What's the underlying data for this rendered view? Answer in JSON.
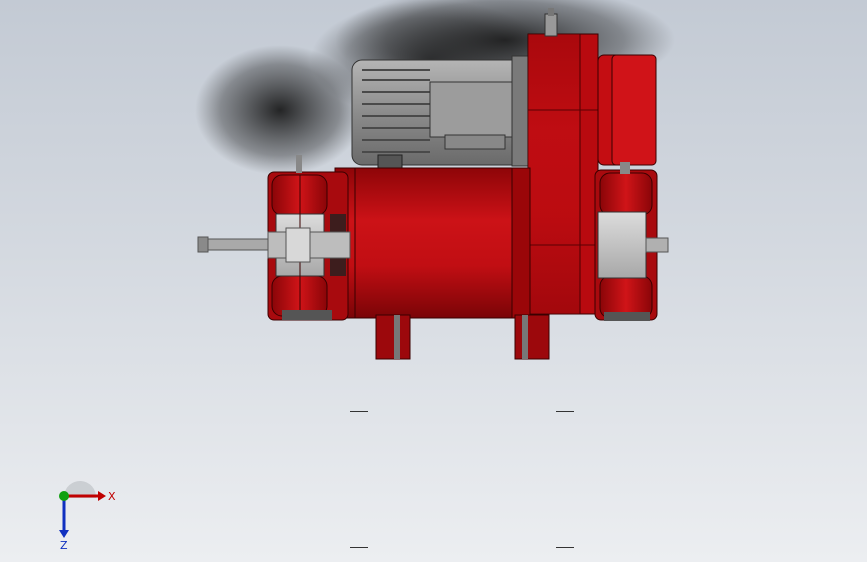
{
  "viewport": {
    "background_top": "#c3cad4",
    "background_bottom": "#eceef1",
    "model_colors": {
      "body_red": "#b20a0e",
      "dark_red": "#7c0508",
      "motor_grey": "#9a9a9a",
      "steel": "#c8c8c8"
    }
  },
  "triad": {
    "x_label": "X",
    "z_label": "Z",
    "x_color": "#c00000",
    "y_color": "#10a010",
    "z_color": "#1030c0"
  }
}
